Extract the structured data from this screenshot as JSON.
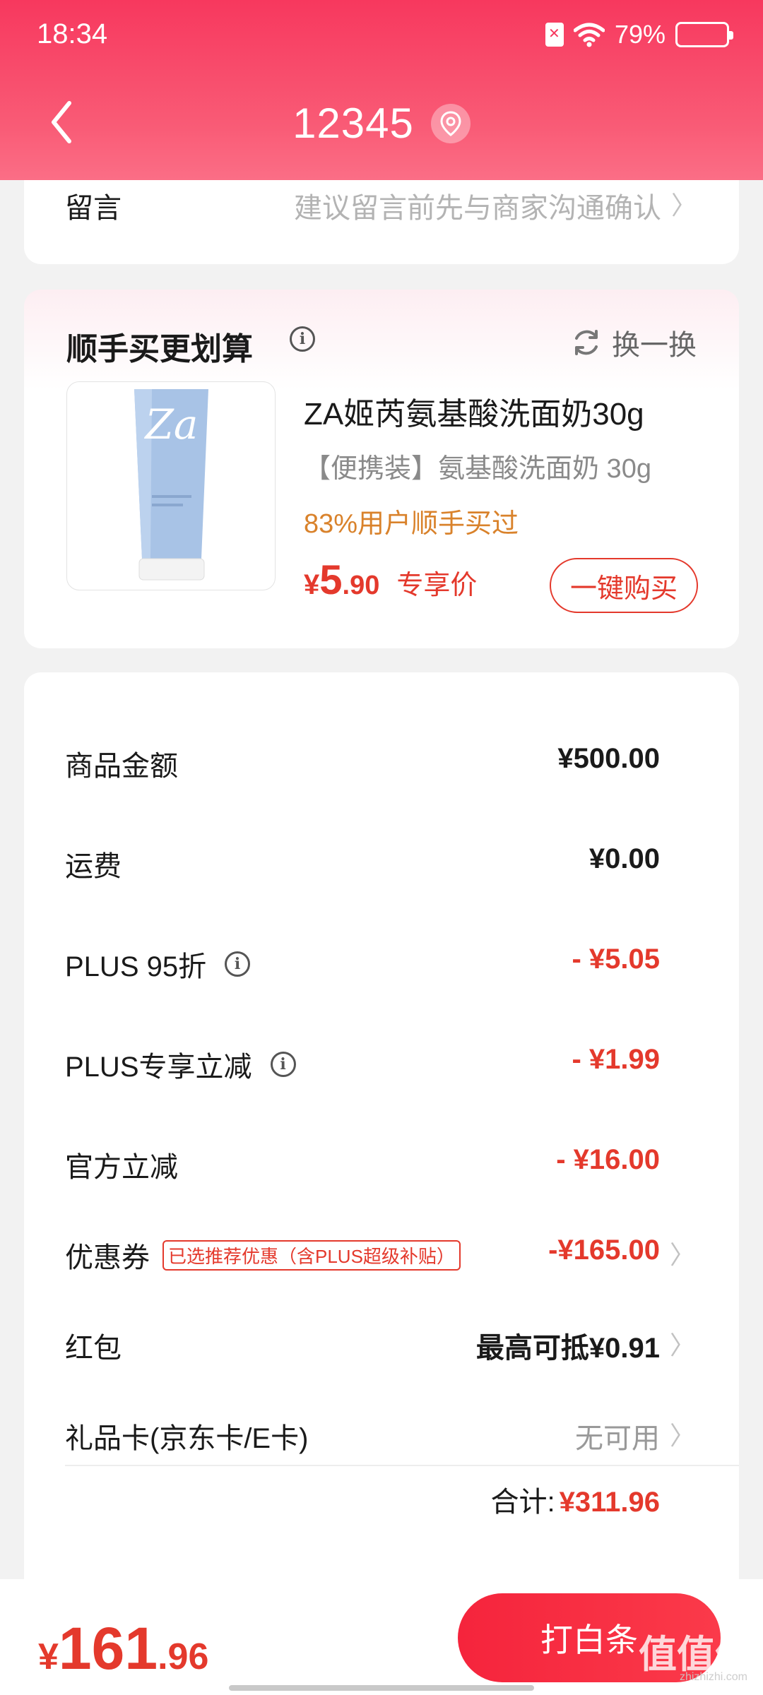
{
  "status_bar": {
    "time": "18:34",
    "battery_pct": "79%",
    "battery_level": 0.79
  },
  "header": {
    "title": "12345"
  },
  "message": {
    "label": "留言",
    "hint": "建议留言前先与商家沟通确认"
  },
  "upsell": {
    "title": "顺手买更划算",
    "swap_label": "换一换",
    "product": {
      "name": "ZA姬芮氨基酸洗面奶30g",
      "subtitle": "【便携装】氨基酸洗面奶 30g",
      "buyers_rate": "83%用户顺手买过",
      "price_symbol": "¥",
      "price_int": "5",
      "price_dec": ".90",
      "price_tag": "专享价",
      "buy_label": "一键购买"
    }
  },
  "summary": {
    "rows": [
      {
        "label": "商品金额",
        "value": "¥500.00"
      },
      {
        "label": "运费",
        "value": "¥0.00"
      },
      {
        "label": "PLUS 95折",
        "value": "- ¥5.05"
      },
      {
        "label": "PLUS专享立减",
        "value": "- ¥1.99"
      },
      {
        "label": "官方立减",
        "value": "- ¥16.00"
      },
      {
        "label": "优惠券",
        "tag": "已选推荐优惠（含PLUS超级补贴）",
        "value": "-¥165.00"
      },
      {
        "label": "红包",
        "value": "最高可抵¥0.91"
      },
      {
        "label": "礼品卡(京东卡/E卡)",
        "value": "无可用"
      }
    ],
    "total_label": "合计:",
    "total_value": "¥311.96"
  },
  "bottom": {
    "price_symbol": "¥",
    "price_int": "161",
    "price_dec": ".96",
    "pay_label": "打白条",
    "watermark": "值值值",
    "watermark_sub": "zhizhizhi.com"
  }
}
